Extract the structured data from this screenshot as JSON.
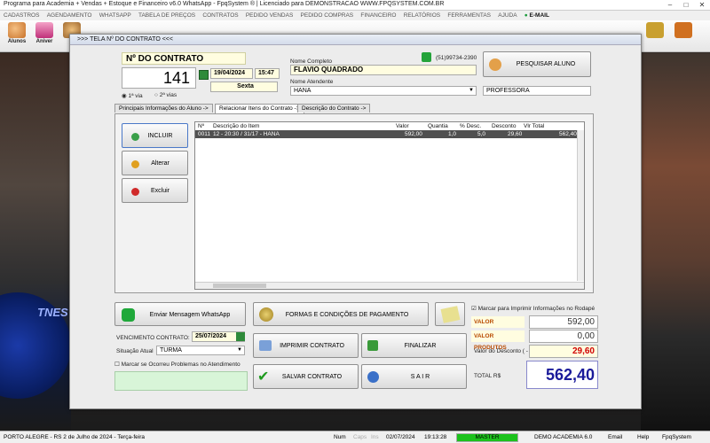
{
  "window_title": "Programa para Academia + Vendas + Estoque e Financeiro v6.0 WhatsApp - FpqSystem ® | Licenciado para  DEMONSTRACAO WWW.FPQSYSTEM.COM.BR",
  "menu": [
    "CADASTROS",
    "AGENDAMENTO",
    "WHATSAPP",
    "TABELA DE PREÇOS",
    "CONTRATOS",
    "PEDIDO VENDAS",
    "PEDIDO COMPRAS",
    "FINANCEIRO",
    "RELATÓRIOS",
    "FERRAMENTAS",
    "AJUDA",
    "E-MAIL"
  ],
  "toolbar": [
    {
      "label": "Alunos",
      "icon": "students-icon"
    },
    {
      "label": "Aniver",
      "icon": "cake-icon"
    },
    {
      "label": "Al",
      "icon": "user-icon"
    }
  ],
  "dialog": {
    "title": ">>>  TELA Nº DO CONTRATO  <<<",
    "contract_header": "Nº DO CONTRATO",
    "contract_number": "141",
    "date": "19/04/2024",
    "time": "15:47",
    "weekday": "Sexta",
    "via1": "1ª via",
    "via2": "2ª vias",
    "name_label": "Nome Completo",
    "name_value": "FLAVIO QUADRADO",
    "phone": "(51)99734-2390",
    "attendant_label": "Nome Atendente",
    "attendant_value": "HANA",
    "role_value": "PROFESSORA",
    "search_button": "PESQUISAR ALUNO",
    "tabs": [
      "Principais Informações do Aluno ->",
      "Relacionar Itens do Contrato ->",
      "Descrição do Contrato ->"
    ],
    "side_buttons": {
      "include": "INCLUIR",
      "edit": "Alterar",
      "delete": "Excluir"
    },
    "grid": {
      "columns": [
        "Nº",
        "Descrição do Item",
        "Valor",
        "Quantia",
        "% Desc.",
        "Desconto",
        "Vlr Total"
      ],
      "rows": [
        [
          "0011",
          "12 - 20:30 / 31/17 - HANA",
          "592,00",
          "1,0",
          "5,0",
          "29,60",
          "562,40"
        ]
      ]
    },
    "whatsapp_button": "Enviar Mensagem WhatsApp",
    "payment_button": "FORMAS E CONDIÇÕES DE PAGAMENTO",
    "print_check": "Marcar para Imprimir Informações no Rodapé",
    "due_label": "VENCIMENTO CONTRATO:",
    "due_value": "25/07/2024",
    "status_label": "Situação Atual",
    "status_value": "TURMA",
    "problem_check": "Marcar se Ocorreu Problemas no Atendimento",
    "print_button": "IMPRIMIR CONTRATO",
    "finish_button": "FINALIZAR",
    "save_button": "SALVAR  CONTRATO",
    "exit_button": "S A I R",
    "services_label": "VALOR SERVICOS",
    "services_value": "592,00",
    "products_label": "VALOR PRODUTOS",
    "products_value": "0,00",
    "discount_label": "Valor do Desconto ( - )",
    "discount_value": "29,60",
    "total_label": "TOTAL R$",
    "total_value": "562,40"
  },
  "statusbar": {
    "location": "PORTO ALEGRE - RS   2 de Julho de 2024 - Terça-feira",
    "num": "Num",
    "caps": "Caps",
    "ins": "Ins",
    "date": "02/07/2024",
    "time": "19:13:28",
    "master": "MASTER",
    "company": "DEMO ACADEMIA 6.0",
    "email": "Email",
    "help": "Help",
    "brand": "FpqSystem"
  },
  "colors": {
    "total_blue": "#1a1a9a",
    "discount_red": "#d00000",
    "label_orange": "#b84a00",
    "highlight_yellow": "#fffde0",
    "status_green": "#1cc21c"
  }
}
